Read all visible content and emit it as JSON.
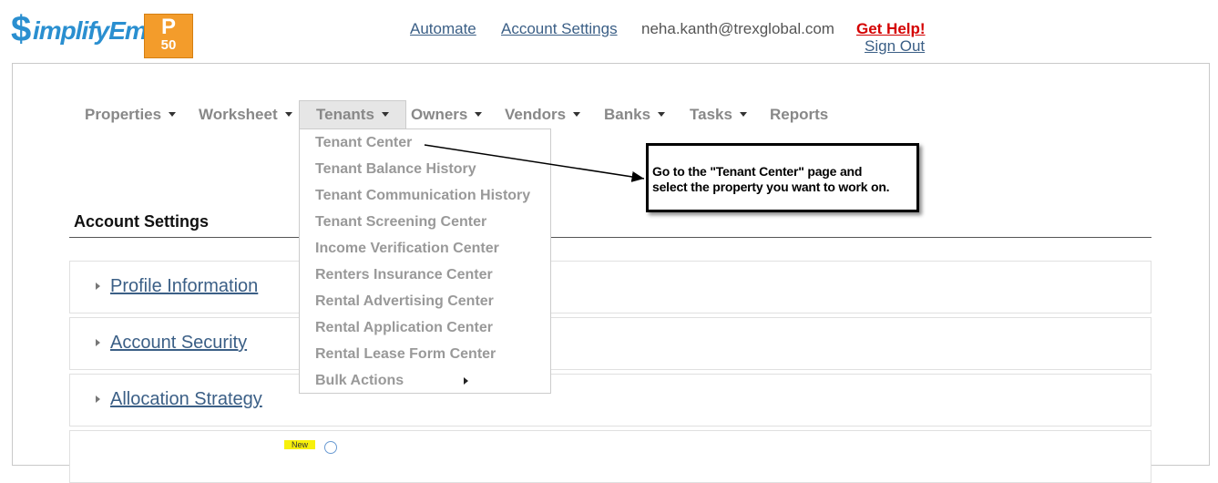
{
  "header": {
    "logo_text": "implifyEm",
    "logo_symbol": "$",
    "plan_badge": {
      "letter": "P",
      "number": "50"
    },
    "links": {
      "automate": "Automate",
      "account_settings": "Account Settings"
    },
    "user_email": "neha.kanth@trexglobal.com",
    "get_help": "Get Help!",
    "sign_out": "Sign Out"
  },
  "nav": {
    "items": [
      {
        "label": "Properties",
        "has_caret": true
      },
      {
        "label": "Worksheet",
        "has_caret": true
      },
      {
        "label": "Tenants",
        "has_caret": true,
        "active": true
      },
      {
        "label": "Owners",
        "has_caret": true
      },
      {
        "label": "Vendors",
        "has_caret": true
      },
      {
        "label": "Banks",
        "has_caret": true
      },
      {
        "label": "Tasks",
        "has_caret": true
      },
      {
        "label": "Reports",
        "has_caret": false
      }
    ]
  },
  "tenants_menu": {
    "items": [
      "Tenant Center",
      "Tenant Balance History",
      "Tenant Communication History",
      "Tenant Screening Center",
      "Income Verification Center",
      "Renters Insurance Center",
      "Rental Advertising Center",
      "Rental Application Center",
      "Rental Lease Form Center",
      "Bulk Actions"
    ]
  },
  "page": {
    "title": "Account Settings",
    "sections": [
      "Profile Information",
      "Account Security",
      "Allocation Strategy"
    ],
    "new_badge": "New"
  },
  "callout": {
    "line1": "Go to the \"Tenant Center\" page and",
    "line2": "select the property you want to work on."
  },
  "colors": {
    "link": "#3b5f86",
    "help": "#d40000",
    "badge": "#f39c2b",
    "logo": "#2a8fd0"
  }
}
